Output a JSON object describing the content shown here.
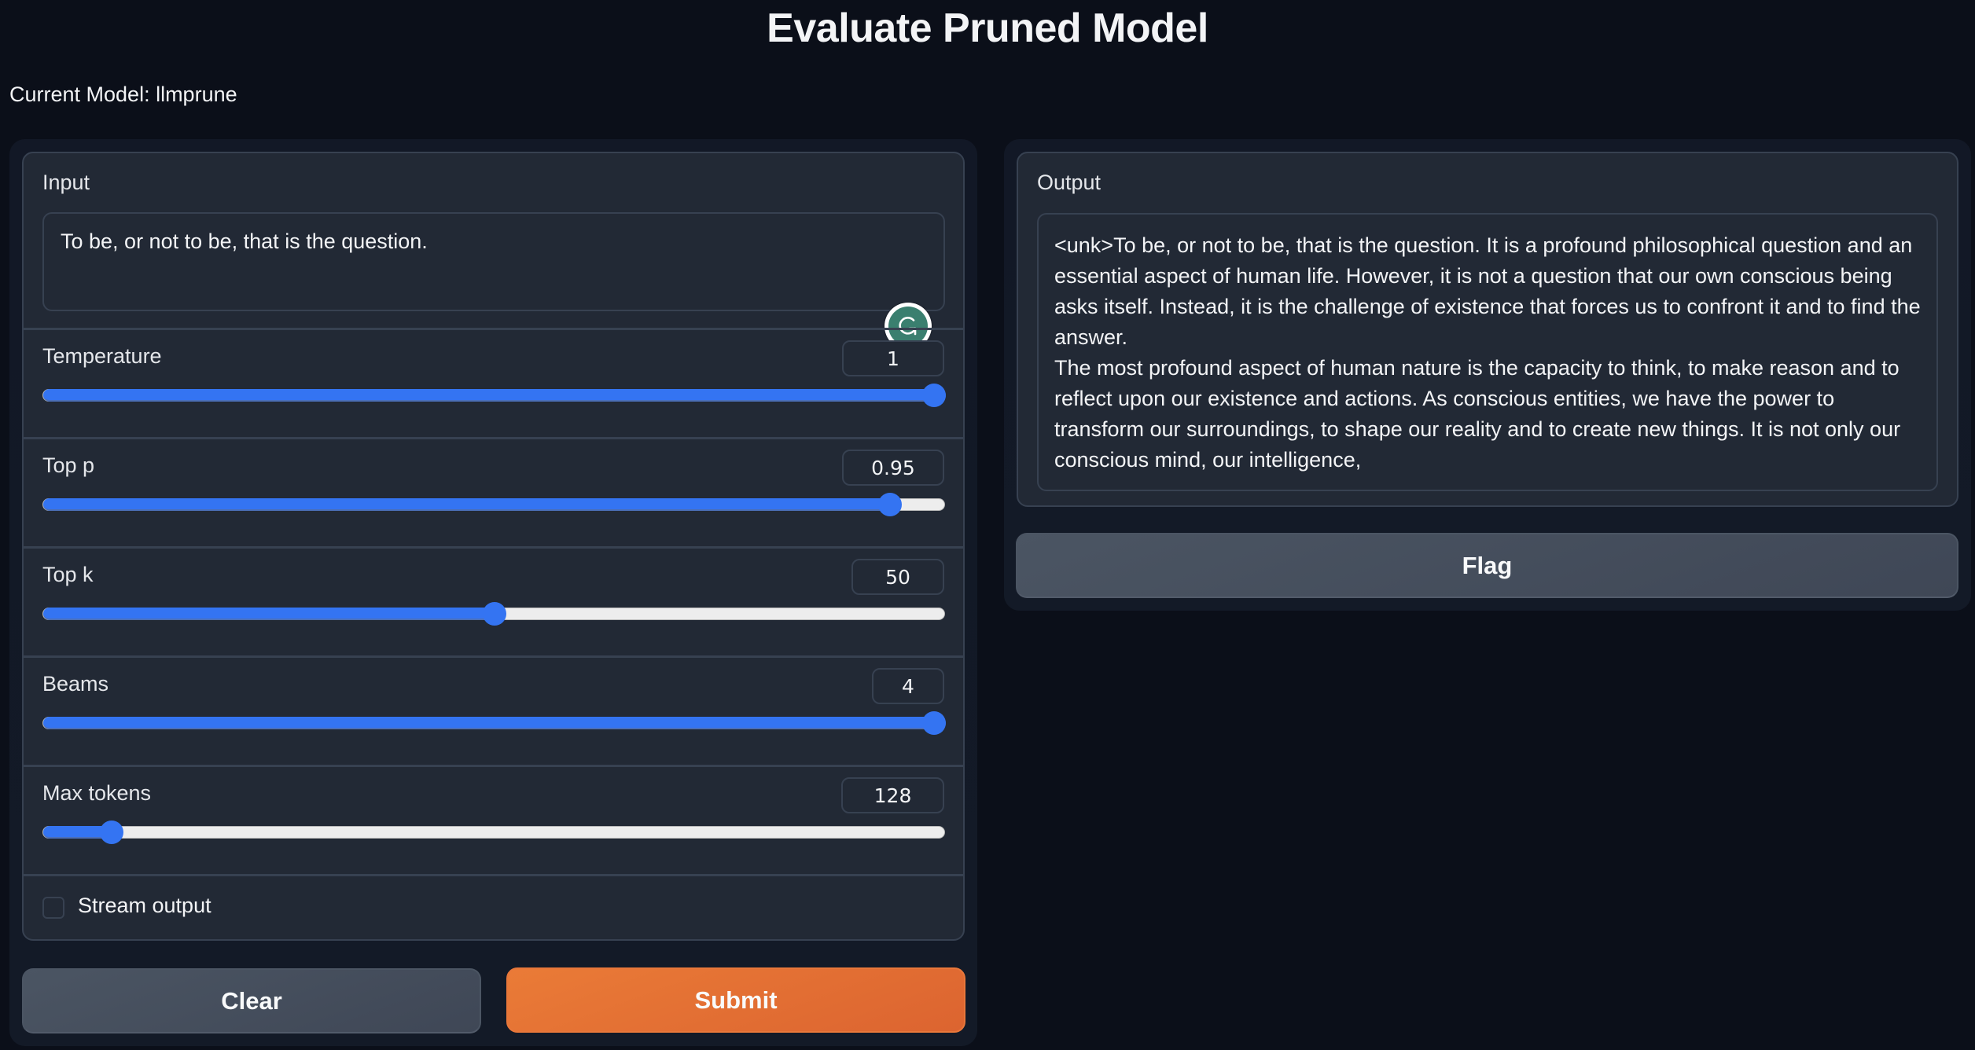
{
  "header": {
    "title": "Evaluate Pruned Model",
    "current_model": "Current Model: llmprune"
  },
  "input": {
    "label": "Input",
    "value": "To be, or not to be, that is the question.",
    "extension_icon": "grammarly-icon"
  },
  "sliders": [
    {
      "label": "Temperature",
      "value": "1",
      "fraction": 1.0
    },
    {
      "label": "Top p",
      "value": "0.95",
      "fraction": 0.95
    },
    {
      "label": "Top k",
      "value": "50",
      "fraction": 0.5
    },
    {
      "label": "Beams",
      "value": "4",
      "fraction": 1.0
    },
    {
      "label": "Max tokens",
      "value": "128",
      "fraction": 0.064
    }
  ],
  "stream_output": {
    "label": "Stream output",
    "checked": false
  },
  "buttons": {
    "clear": "Clear",
    "submit": "Submit",
    "flag": "Flag"
  },
  "output": {
    "label": "Output",
    "paragraphs": [
      "<unk>To be, or not to be, that is the question. It is a profound philosophical question and an essential aspect of human life. However, it is not a question that our own conscious being asks itself. Instead, it is the challenge of existence that forces us to confront it and to find the answer.",
      "The most profound aspect of human nature is the capacity to think, to make reason and to reflect upon our existence and actions. As conscious entities, we have the power to transform our surroundings, to shape our reality and to create new things. It is not only our conscious mind, our intelligence,"
    ]
  },
  "colors": {
    "accent": "#3474f2",
    "primary_button": "#e8773a",
    "background": "#0b0f19",
    "block": "#222935"
  }
}
